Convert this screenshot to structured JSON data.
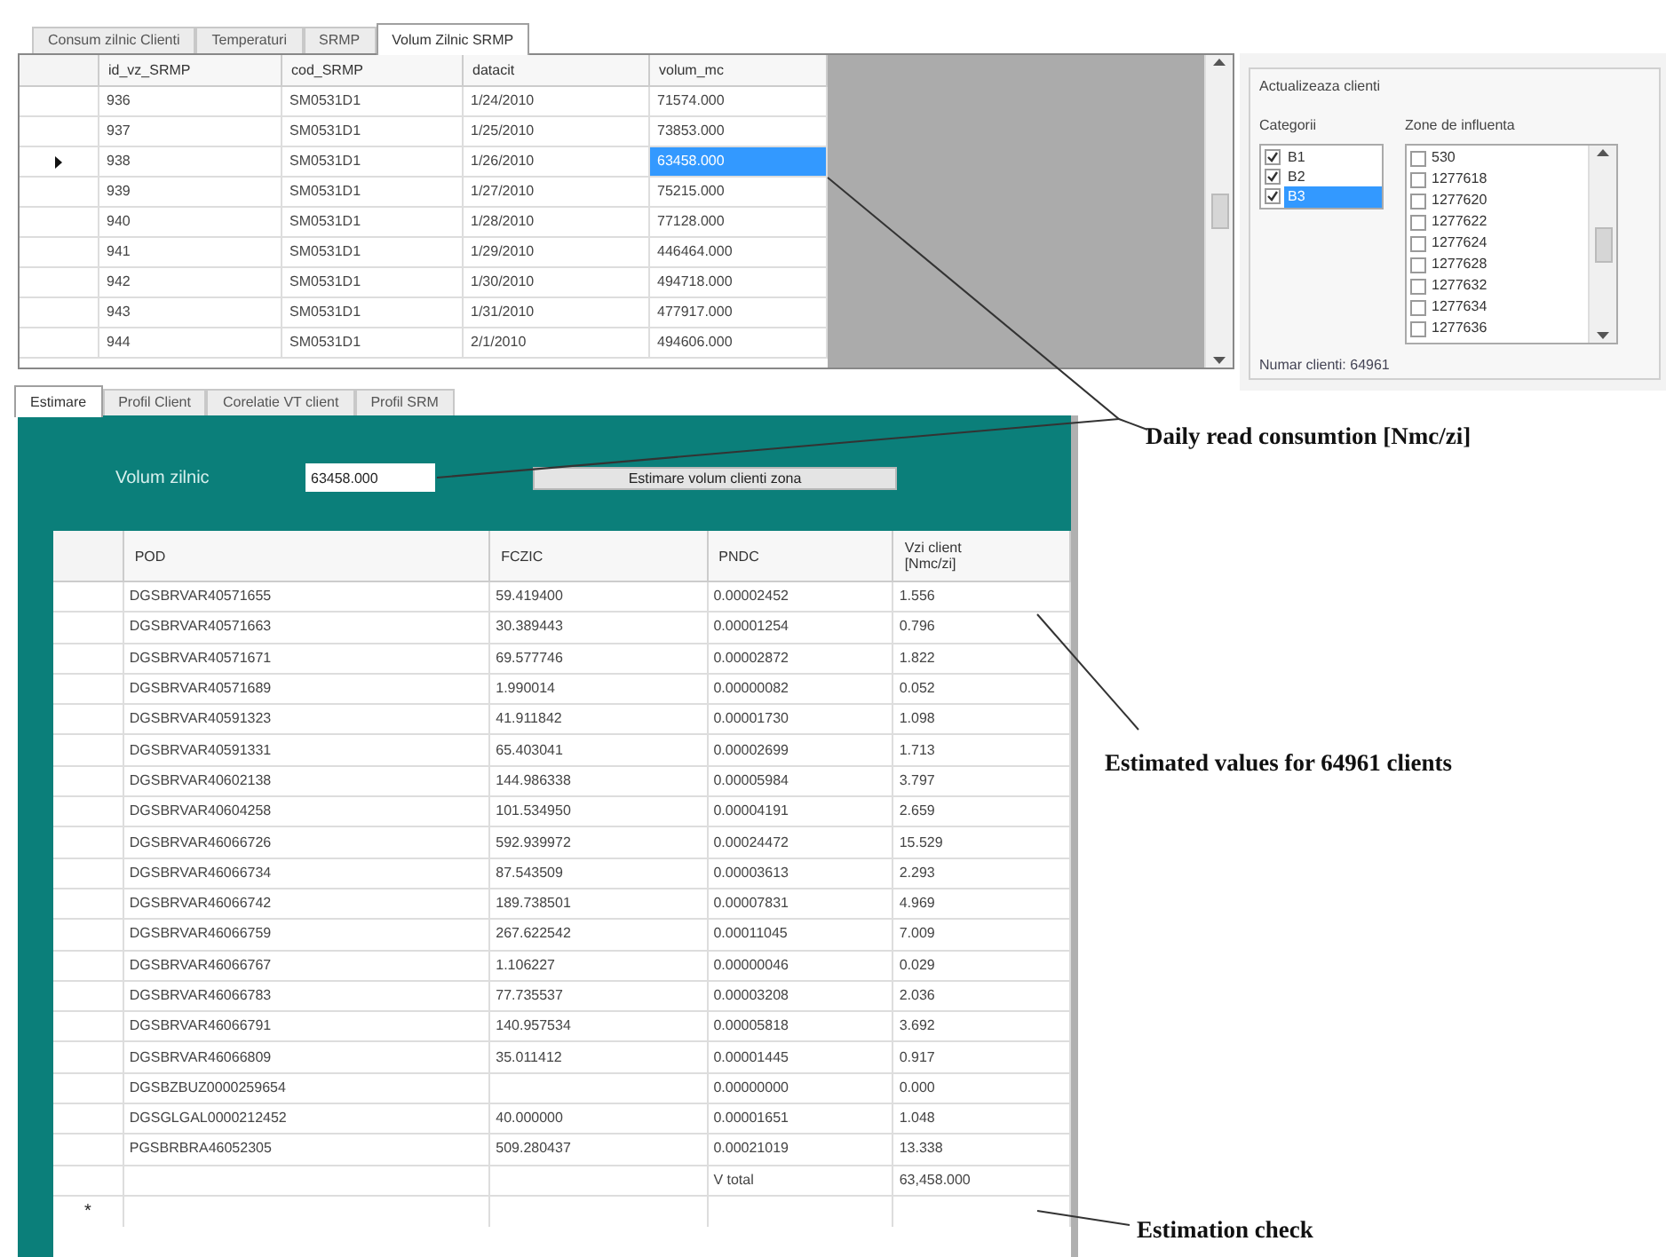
{
  "top_tabs": [
    {
      "label": "Consum zilnic Clienti",
      "selected": false
    },
    {
      "label": "Temperaturi",
      "selected": false
    },
    {
      "label": "SRMP",
      "selected": false
    },
    {
      "label": "Volum Zilnic SRMP",
      "selected": true
    }
  ],
  "srmp_table": {
    "columns": [
      "id_vz_SRMP",
      "cod_SRMP",
      "datacit",
      "volum_mc"
    ],
    "rows": [
      {
        "cells": [
          "936",
          "SM0531D1",
          "1/24/2010",
          "71574.000"
        ],
        "selected": false
      },
      {
        "cells": [
          "937",
          "SM0531D1",
          "1/25/2010",
          "73853.000"
        ],
        "selected": false
      },
      {
        "cells": [
          "938",
          "SM0531D1",
          "1/26/2010",
          "63458.000"
        ],
        "selected": true
      },
      {
        "cells": [
          "939",
          "SM0531D1",
          "1/27/2010",
          "75215.000"
        ],
        "selected": false
      },
      {
        "cells": [
          "940",
          "SM0531D1",
          "1/28/2010",
          "77128.000"
        ],
        "selected": false
      },
      {
        "cells": [
          "941",
          "SM0531D1",
          "1/29/2010",
          "446464.000"
        ],
        "selected": false
      },
      {
        "cells": [
          "942",
          "SM0531D1",
          "1/30/2010",
          "494718.000"
        ],
        "selected": false
      },
      {
        "cells": [
          "943",
          "SM0531D1",
          "1/31/2010",
          "477917.000"
        ],
        "selected": false
      },
      {
        "cells": [
          "944",
          "SM0531D1",
          "2/1/2010",
          "494606.000"
        ],
        "selected": false
      }
    ]
  },
  "client_update": {
    "title": "Actualizeaza clienti",
    "categories_label": "Categorii",
    "categories": [
      {
        "label": "B1",
        "checked": true,
        "selected": false
      },
      {
        "label": "B2",
        "checked": true,
        "selected": false
      },
      {
        "label": "B3",
        "checked": true,
        "selected": true
      }
    ],
    "zones_label": "Zone de influenta",
    "zones": [
      {
        "label": "530",
        "checked": false
      },
      {
        "label": "1277618",
        "checked": false
      },
      {
        "label": "1277620",
        "checked": false
      },
      {
        "label": "1277622",
        "checked": false
      },
      {
        "label": "1277624",
        "checked": false
      },
      {
        "label": "1277628",
        "checked": false
      },
      {
        "label": "1277632",
        "checked": false
      },
      {
        "label": "1277634",
        "checked": false
      },
      {
        "label": "1277636",
        "checked": false
      }
    ],
    "client_count": "Numar clienti: 64961"
  },
  "bottom_tabs": [
    {
      "label": "Estimare",
      "selected": true
    },
    {
      "label": "Profil Client",
      "selected": false
    },
    {
      "label": "Corelatie VT client",
      "selected": false
    },
    {
      "label": "Profil SRM",
      "selected": false
    }
  ],
  "estimation": {
    "volume_label": "Volum zilnic",
    "volume_value": "63458.000",
    "estimate_button": "Estimare volum clienti zona",
    "columns": [
      "POD",
      "FCZIC",
      "PNDC",
      "Vzi client [Nmc/zi]"
    ],
    "rows": [
      [
        "DGSBRVAR40571655",
        "59.419400",
        "0.00002452",
        "1.556"
      ],
      [
        "DGSBRVAR40571663",
        "30.389443",
        "0.00001254",
        "0.796"
      ],
      [
        "DGSBRVAR40571671",
        "69.577746",
        "0.00002872",
        "1.822"
      ],
      [
        "DGSBRVAR40571689",
        "1.990014",
        "0.00000082",
        "0.052"
      ],
      [
        "DGSBRVAR40591323",
        "41.911842",
        "0.00001730",
        "1.098"
      ],
      [
        "DGSBRVAR40591331",
        "65.403041",
        "0.00002699",
        "1.713"
      ],
      [
        "DGSBRVAR40602138",
        "144.986338",
        "0.00005984",
        "3.797"
      ],
      [
        "DGSBRVAR40604258",
        "101.534950",
        "0.00004191",
        "2.659"
      ],
      [
        "DGSBRVAR46066726",
        "592.939972",
        "0.00024472",
        "15.529"
      ],
      [
        "DGSBRVAR46066734",
        "87.543509",
        "0.00003613",
        "2.293"
      ],
      [
        "DGSBRVAR46066742",
        "189.738501",
        "0.00007831",
        "4.969"
      ],
      [
        "DGSBRVAR46066759",
        "267.622542",
        "0.00011045",
        "7.009"
      ],
      [
        "DGSBRVAR46066767",
        "1.106227",
        "0.00000046",
        "0.029"
      ],
      [
        "DGSBRVAR46066783",
        "77.735537",
        "0.00003208",
        "2.036"
      ],
      [
        "DGSBRVAR46066791",
        "140.957534",
        "0.00005818",
        "3.692"
      ],
      [
        "DGSBRVAR46066809",
        "35.011412",
        "0.00001445",
        "0.917"
      ],
      [
        "DGSBZBUZ0000259654",
        "",
        "0.00000000",
        "0.000"
      ],
      [
        "DGSGLGAL0000212452",
        "40.000000",
        "0.00001651",
        "1.048"
      ],
      [
        "PGSBRBRA46052305",
        "509.280437",
        "0.00021019",
        "13.338"
      ],
      [
        "",
        "",
        "V total",
        "63,458.000"
      ]
    ],
    "new_row_marker": "*"
  },
  "annotations": [
    "Daily read consumtion [Nmc/zi]",
    "Estimated values for 64961 clients",
    "Estimation check"
  ]
}
